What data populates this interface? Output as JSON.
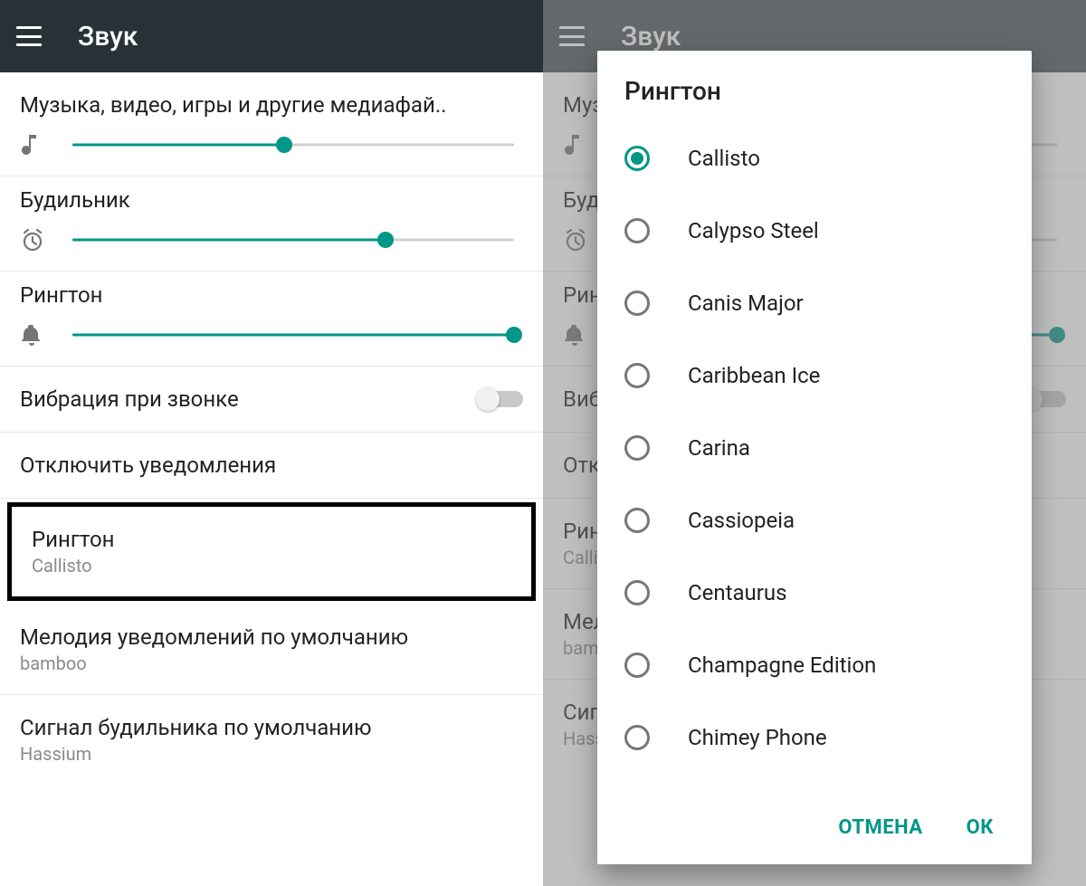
{
  "colors": {
    "accent": "#009688",
    "appbar": "#263238"
  },
  "appbar": {
    "title": "Звук"
  },
  "sliders": {
    "media": {
      "label": "Музыка, видео, игры и другие медиафай..",
      "value_pct": 48
    },
    "alarm": {
      "label": "Будильник",
      "value_pct": 71
    },
    "ringtone": {
      "label": "Рингтон",
      "value_pct": 100
    }
  },
  "rows": {
    "vibrate": {
      "label": "Вибрация при звонке",
      "on": false
    },
    "dnd": {
      "label": "Отключить уведомления"
    },
    "ringtone_pick": {
      "label": "Рингтон",
      "value": "Callisto"
    },
    "notif_sound": {
      "label": "Мелодия уведомлений по умолчанию",
      "value": "bamboo"
    },
    "alarm_sound": {
      "label": "Сигнал будильника по умолчанию",
      "value": "Hassium"
    }
  },
  "dialog": {
    "title": "Рингтон",
    "selected_index": 0,
    "options": [
      "Callisto",
      "Calypso Steel",
      "Canis Major",
      "Caribbean Ice",
      "Carina",
      "Cassiopeia",
      "Centaurus",
      "Champagne Edition",
      "Chimey Phone"
    ],
    "cancel": "ОТМЕНА",
    "ok": "ОК"
  }
}
